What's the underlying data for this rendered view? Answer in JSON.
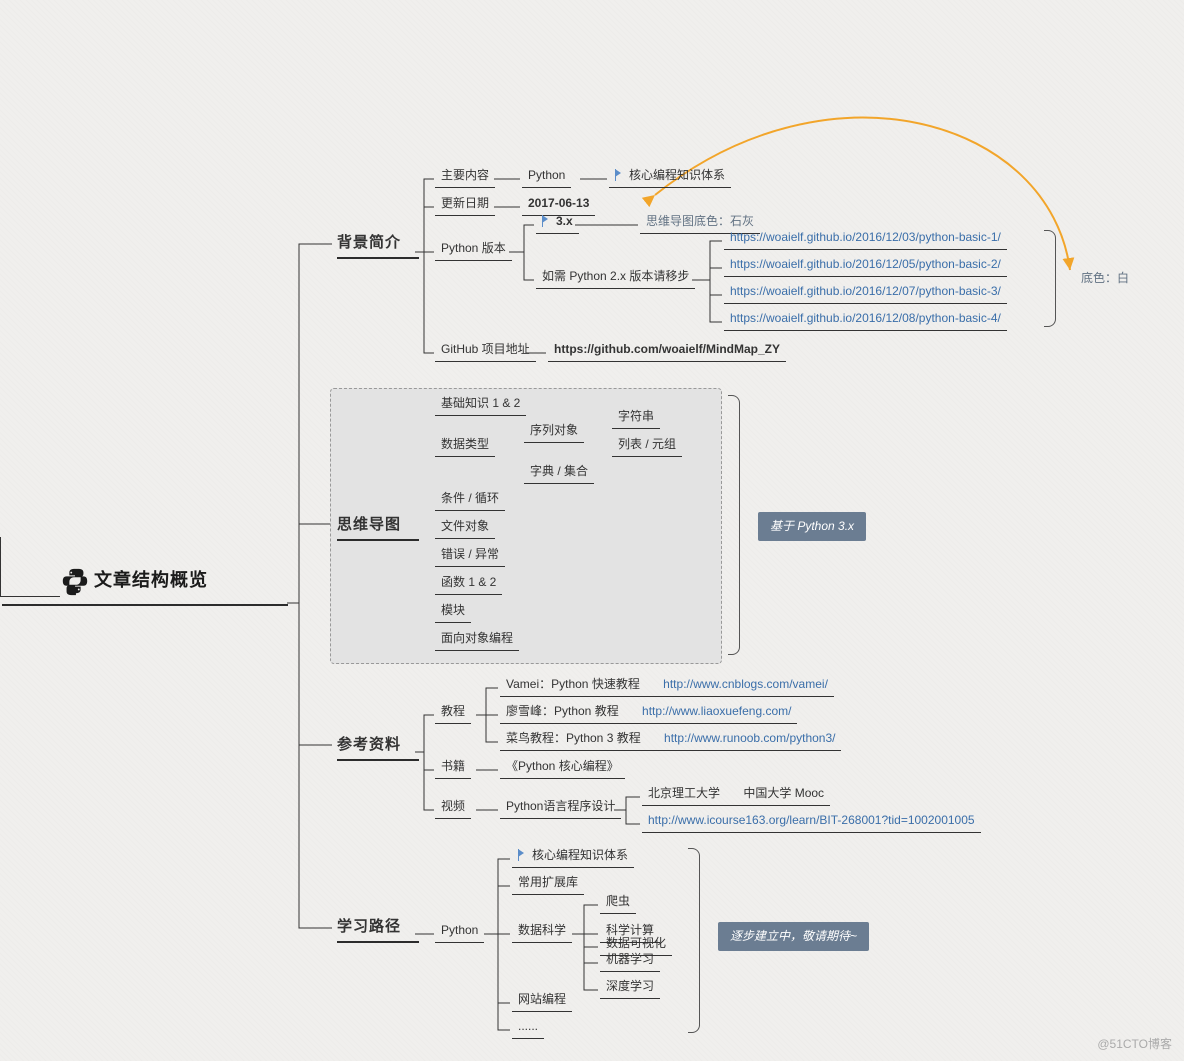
{
  "root": {
    "title": "文章结构概览"
  },
  "bg_intro": {
    "title": "背景简介",
    "main_content_label": "主要内容",
    "main_content_value": "Python",
    "flag_core": "核心编程知识体系",
    "update_label": "更新日期",
    "update_value": "2017-06-13",
    "pyver_label": "Python 版本",
    "pyver_3x": "3.x",
    "bgcolor_lime_note": "思维导图底色：石灰",
    "pyver_2x_note": "如需 Python 2.x 版本请移步",
    "links": {
      "a": "https://woaielf.github.io/2016/12/03/python-basic-1/",
      "b": "https://woaielf.github.io/2016/12/05/python-basic-2/",
      "c": "https://woaielf.github.io/2016/12/07/python-basic-3/",
      "d": "https://woaielf.github.io/2016/12/08/python-basic-4/"
    },
    "bgcolor_white_note": "底色：白",
    "github_label": "GitHub 项目地址",
    "github_url": "https://github.com/woaielf/MindMap_ZY"
  },
  "mindmap": {
    "title": "思维导图",
    "items": {
      "a": "基础知识 1 & 2",
      "b": "数据类型",
      "b1": "序列对象",
      "b1a": "字符串",
      "b1b": "列表 / 元组",
      "b2": "字典 / 集合",
      "c": "条件 / 循环",
      "d": "文件对象",
      "e": "错误 / 异常",
      "f": "函数 1 & 2",
      "g": "模块",
      "h": "面向对象编程"
    },
    "callout": "基于 Python 3.x"
  },
  "refs": {
    "title": "参考资料",
    "tutorial_label": "教程",
    "book_label": "书籍",
    "video_label": "视频",
    "tutorials": {
      "a_name": "Vamei：Python 快速教程",
      "a_url": "http://www.cnblogs.com/vamei/",
      "b_name": "廖雪峰：Python 教程",
      "b_url": "http://www.liaoxuefeng.com/",
      "c_name": "菜鸟教程：Python 3 教程",
      "c_url": "http://www.runoob.com/python3/"
    },
    "book_value": "《Python 核心编程》",
    "video_name": "Python语言程序设计",
    "video_school": "北京理工大学",
    "video_platform": "中国大学 Mooc",
    "video_url": "http://www.icourse163.org/learn/BIT-268001?tid=1002001005"
  },
  "path": {
    "title": "学习路径",
    "root": "Python",
    "items": {
      "a": "核心编程知识体系",
      "b": "常用扩展库",
      "c": "数据科学",
      "c1": "爬虫",
      "c2": "科学计算",
      "c3": "数据可视化",
      "c4": "机器学习",
      "c5": "深度学习",
      "d": "网站编程",
      "e": "......"
    },
    "callout": "逐步建立中，敬请期待~"
  },
  "watermark": "@51CTO博客"
}
